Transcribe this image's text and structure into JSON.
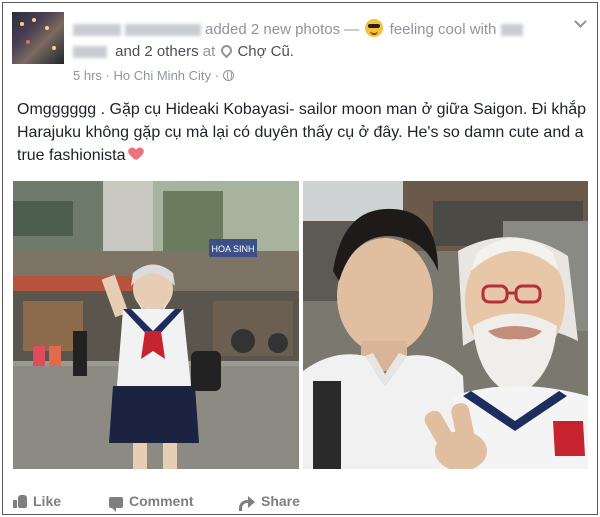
{
  "post": {
    "header_line1": {
      "action": "added 2 new photos",
      "dash": "—",
      "feeling": "feeling cool with"
    },
    "header_line2": {
      "others": "and 2 others",
      "at": "at",
      "place": "Chợ Cũ."
    },
    "meta": {
      "time": "5 hrs",
      "separator": "·",
      "location": "Ho Chi Minh City",
      "separator2": "·"
    },
    "text": "Omgggggg . Gặp cụ Hideaki Kobayasi- sailor moon man ở giữa Saigon. Đi khắp Harajuku không gặp cụ mà lại có duyên thấy cụ ở đây. He's so damn cute and a true fashionista",
    "sign_text": "HOA SINH"
  },
  "actions": {
    "like": "Like",
    "comment": "Comment",
    "share": "Share"
  },
  "icons": {
    "feeling_emoji": "cool-sunglasses-emoji",
    "place": "location-pin-icon",
    "audience": "globe-icon",
    "options": "chevron-down-icon",
    "heart": "pink-heart-emoji"
  },
  "colors": {
    "meta_text": "#90949c",
    "body_text": "#1d2129",
    "action_text": "#7f7f7f",
    "heart": "#e9737e"
  }
}
